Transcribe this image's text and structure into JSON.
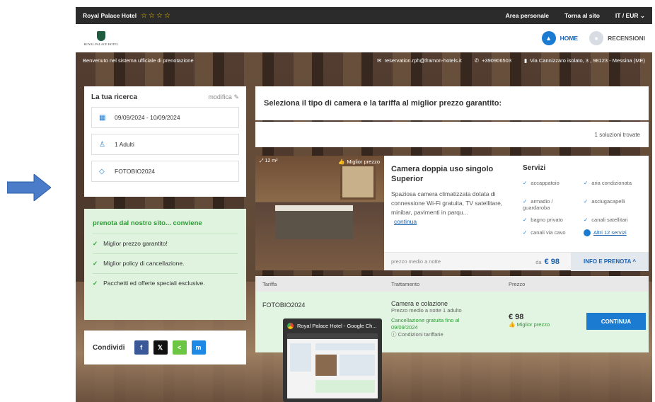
{
  "colors": {
    "primary_blue": "#1b7bd0",
    "success_green": "#2e9b36",
    "topbar": "#2b2b2b"
  },
  "topbar": {
    "brand": "Royal Palace Hotel",
    "stars": "☆☆☆☆",
    "area": "Area personale",
    "back": "Torna al sito",
    "locale": "IT / EUR ⌄"
  },
  "logo": {
    "text": "ROYAL PALACE HOTEL"
  },
  "nav": {
    "home": "HOME",
    "reviews": "RECENSIONI"
  },
  "welcome": {
    "text": "Benvenuto nel sistema ufficiale di prenotazione",
    "email": "reservation.rph@framon-hotels.it",
    "phone": "+390906503",
    "address": "Via Cannizzaro isolato, 3 , 98123 - Messina (ME)"
  },
  "search": {
    "title": "La tua ricerca",
    "edit": "modifica",
    "dates": "09/09/2024 - 10/09/2024",
    "guests": "1 Adulti",
    "promo_code": "FOTOBIO2024"
  },
  "promo": {
    "title": "prenota dal nostro sito... conviene",
    "items": [
      "Miglior prezzo garantito!",
      "Miglior policy di cancellazione.",
      "Pacchetti ed offerte speciali esclusive."
    ]
  },
  "share": {
    "label": "Condividi",
    "buttons": [
      "f",
      "𝕏",
      "<",
      "m"
    ]
  },
  "main": {
    "heading": "Seleziona il tipo di camera e la tariffa al miglior prezzo garantito:",
    "found": "1 soluzioni trovate"
  },
  "room": {
    "size": "12 m²",
    "best_badge": "Miglior prezzo",
    "title": "Camera doppia uso singolo Superior",
    "desc": "Spaziosa camera climatizzata dotata di connessione Wi-Fi gratuita, TV satellitare, minibar, pavimenti in parqu...",
    "more": "continua",
    "services_title": "Servizi",
    "services": [
      "accappatoio",
      "aria condizionata",
      "armadio / guardaroba",
      "asciugacapelli",
      "bagno privato",
      "canali satellitari",
      "canali via cavo"
    ],
    "other_services": "Altri 12 servizi",
    "avg_label": "prezzo medio a notte",
    "from": "da",
    "price": "€ 98",
    "info": "INFO E PRENOTA ^"
  },
  "rates": {
    "headers": [
      "Tariffa",
      "Trattamento",
      "Prezzo",
      ""
    ],
    "row": {
      "name": "FOTOBIO2024",
      "treatment": "Camera e colazione",
      "avg": "Prezzo medio a notte 1 adulto",
      "cancel": "Cancellazione gratuita fino al 09/09/2024",
      "conditions": "ⓘ Condizioni tariffarie",
      "price": "€ 98",
      "best": "Miglior prezzo",
      "button": "CONTINUA"
    }
  },
  "popup": {
    "title": "Royal Palace Hotel - Google Ch..."
  }
}
